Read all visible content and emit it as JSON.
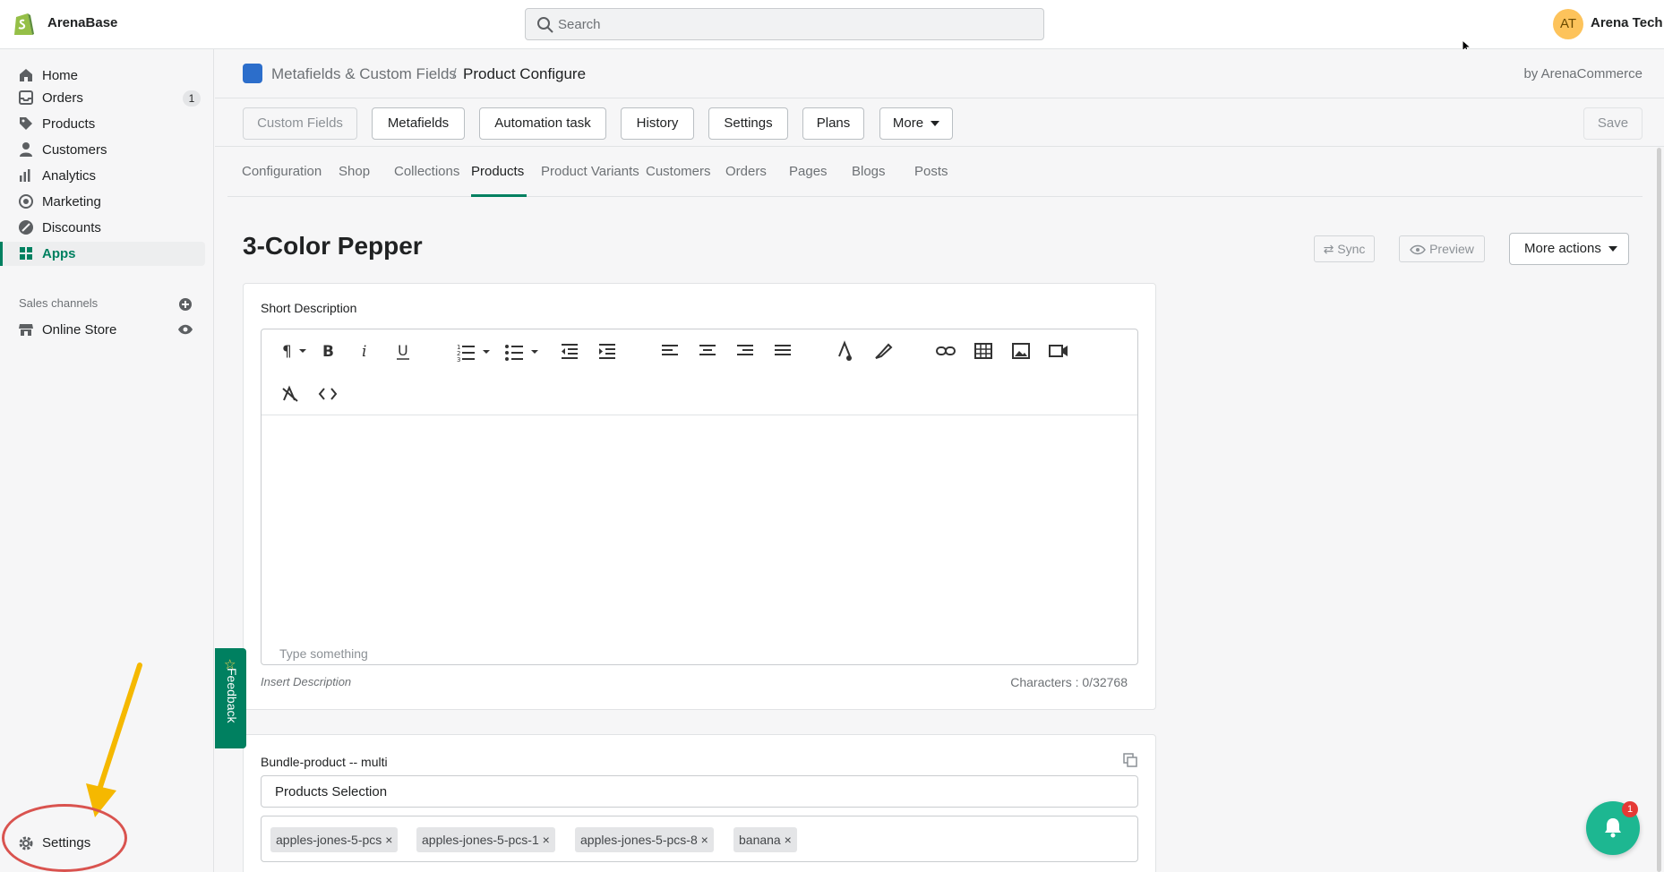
{
  "topbar": {
    "store_name": "ArenaBase",
    "search_placeholder": "Search",
    "user_initials": "AT",
    "user_name": "Arena Tech"
  },
  "sidebar": {
    "items": [
      {
        "label": "Home",
        "icon": "home-icon"
      },
      {
        "label": "Orders",
        "icon": "orders-icon",
        "badge": "1"
      },
      {
        "label": "Products",
        "icon": "tag-icon"
      },
      {
        "label": "Customers",
        "icon": "person-icon"
      },
      {
        "label": "Analytics",
        "icon": "bar-chart-icon"
      },
      {
        "label": "Marketing",
        "icon": "target-icon"
      },
      {
        "label": "Discounts",
        "icon": "discount-icon"
      },
      {
        "label": "Apps",
        "icon": "apps-icon",
        "active": true
      }
    ],
    "sales_channels_title": "Sales channels",
    "online_store_label": "Online Store",
    "settings_label": "Settings"
  },
  "breadcrumb": {
    "app": "Metafields & Custom Fields",
    "separator": "/",
    "page": "Product Configure",
    "byline": "by ArenaCommerce"
  },
  "toolbar": {
    "buttons": [
      "Custom Fields",
      "Metafields",
      "Automation task",
      "History",
      "Settings",
      "Plans",
      "More"
    ],
    "save_label": "Save"
  },
  "tabs": [
    "Configuration",
    "Shop",
    "Collections",
    "Products",
    "Product Variants",
    "Customers",
    "Orders",
    "Pages",
    "Blogs",
    "Posts"
  ],
  "active_tab": "Products",
  "product": {
    "title": "3-Color Pepper",
    "sync_label": "Sync",
    "preview_label": "Preview",
    "more_actions_label": "More actions"
  },
  "short_description": {
    "label": "Short Description",
    "placeholder": "Type something",
    "hint": "Insert Description",
    "char_count": "Characters : 0/32768"
  },
  "bundle": {
    "label": "Bundle-product -- multi",
    "selection_value": "Products Selection",
    "tags": [
      "apples-jones-5-pcs",
      "apples-jones-5-pcs-1",
      "apples-jones-5-pcs-8",
      "banana"
    ]
  },
  "feedback_label": "Feedback",
  "notification_count": "1",
  "colors": {
    "accent": "#008060",
    "annotation_ellipse": "#d9534f",
    "annotation_arrow": "#f5b800",
    "notification": "#1db791"
  }
}
